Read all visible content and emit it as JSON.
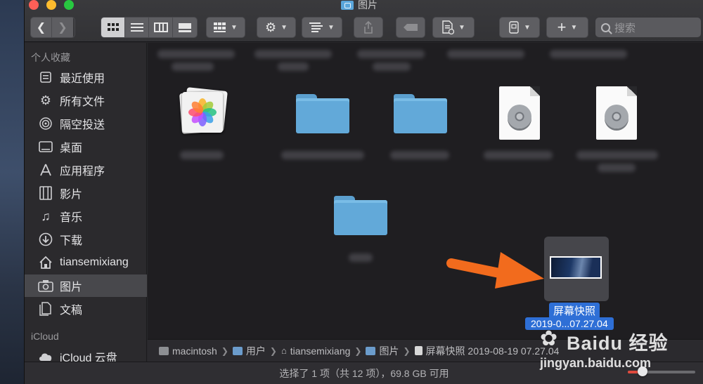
{
  "window": {
    "title": "图片"
  },
  "toolbar": {
    "back_icon": "chevron-left-icon",
    "forward_icon": "chevron-right-icon",
    "view_modes": [
      "icon-view",
      "list-view",
      "column-view",
      "gallery-view"
    ],
    "active_view": "icon-view",
    "search_placeholder": "搜索"
  },
  "sidebar": {
    "favorites_header": "个人收藏",
    "favorites": [
      {
        "label": "最近使用",
        "icon": "recents-icon"
      },
      {
        "label": "所有文件",
        "icon": "gear-icon"
      },
      {
        "label": "隔空投送",
        "icon": "airdrop-icon"
      },
      {
        "label": "桌面",
        "icon": "desktop-icon"
      },
      {
        "label": "应用程序",
        "icon": "applications-icon"
      },
      {
        "label": "影片",
        "icon": "film-icon"
      },
      {
        "label": "音乐",
        "icon": "music-icon"
      },
      {
        "label": "下载",
        "icon": "download-icon"
      },
      {
        "label": "tiansemixiang",
        "icon": "home-icon"
      },
      {
        "label": "图片",
        "icon": "camera-icon",
        "selected": true
      },
      {
        "label": "文稿",
        "icon": "document-icon"
      }
    ],
    "icloud_header": "iCloud",
    "icloud": [
      {
        "label": "iCloud 云盘",
        "icon": "cloud-icon"
      }
    ]
  },
  "content": {
    "items": [
      {
        "kind": "photos-library"
      },
      {
        "kind": "folder"
      },
      {
        "kind": "folder"
      },
      {
        "kind": "disk-image"
      },
      {
        "kind": "disk-image"
      },
      {
        "kind": "folder"
      }
    ],
    "selected_file": {
      "name_line1": "屏幕快照",
      "name_line2": "2019-0...07.27.04"
    }
  },
  "pathbar": {
    "crumbs": [
      "macintosh",
      "用户",
      "tiansemixiang",
      "图片",
      "屏幕快照 2019-08-19 07.27.04"
    ]
  },
  "statusbar": {
    "text": "选择了 1 项（共 12 项），69.8 GB 可用",
    "icon_size_fraction": 0.22
  },
  "watermark": {
    "brand": "Baidu 经验",
    "url": "jingyan.baidu.com"
  },
  "colors": {
    "selection": "#2e6fd6",
    "folder": "#62a9d9",
    "arrow": "#f26b1d"
  }
}
